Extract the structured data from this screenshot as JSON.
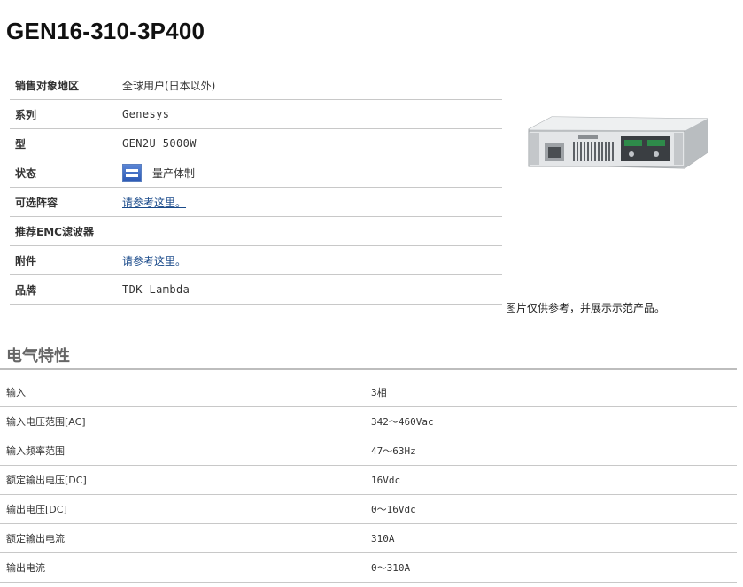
{
  "product": {
    "title": "GEN16-310-3P400"
  },
  "specs": {
    "region_label": "销售对象地区",
    "region_value": "全球用户(日本以外)",
    "series_label": "系列",
    "series_value": "Genesys",
    "model_label": "型",
    "model_value": "GEN2U 5000W",
    "status_label": "状态",
    "status_value": "量产体制",
    "options_label": "可选阵容",
    "options_link": "请参考这里。",
    "emc_label": "推荐EMC滤波器",
    "emc_value": "",
    "accessory_label": "附件",
    "accessory_link": "请参考这里。",
    "brand_label": "品牌",
    "brand_value": "TDK-Lambda"
  },
  "image": {
    "caption": "图片仅供参考，并展示示范产品。"
  },
  "electrical": {
    "title": "电气特性",
    "rows": [
      {
        "label": "输入",
        "value": "3相"
      },
      {
        "label": "输入电压范围[AC]",
        "value": "342～460Vac"
      },
      {
        "label": "输入频率范围",
        "value": "47～63Hz"
      },
      {
        "label": "额定输出电压[DC]",
        "value": "16Vdc"
      },
      {
        "label": "输出电压[DC]",
        "value": "0～16Vdc"
      },
      {
        "label": "额定输出电流",
        "value": "310A"
      },
      {
        "label": "输出电流",
        "value": "0～310A"
      }
    ]
  },
  "colors": {
    "link": "#1a4a8a",
    "status_icon": "#2e5bb5",
    "rule": "#bdbdbd"
  }
}
